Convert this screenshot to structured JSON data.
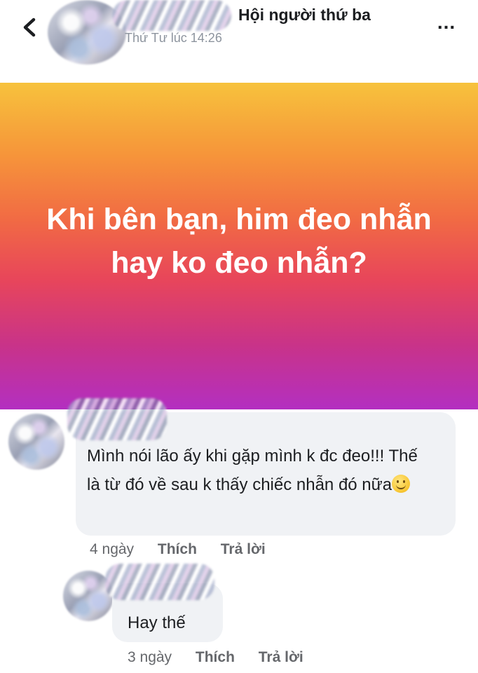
{
  "header": {
    "group_name": "Hội người thứ ba",
    "post_time": "Thứ Tư lúc 14:26",
    "more_label": "..."
  },
  "post": {
    "text": "Khi bên bạn, him đeo nhẫn hay ko đeo nhẫn?"
  },
  "comments": [
    {
      "text": "Mình nói lão ấy khi gặp mình k đc đeo!!! Thế là từ đó về sau k thấy chiếc nhẫn đó nữa",
      "emoji": "smiling-face",
      "time": "4 ngày",
      "like_label": "Thích",
      "reply_label": "Trả lời"
    },
    {
      "text": "Hay thế",
      "time": "3 ngày",
      "like_label": "Thích",
      "reply_label": "Trả lời"
    }
  ],
  "colors": {
    "banner_gradient": [
      "#f7c23c",
      "#f16a44",
      "#b32fc1"
    ],
    "bubble": "#f0f2f5",
    "meta_text": "#65676b"
  }
}
